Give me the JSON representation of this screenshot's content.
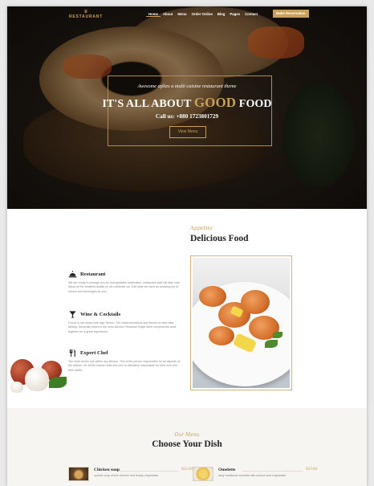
{
  "nav": {
    "logo_text": "RESTAURANT",
    "items": [
      "Home",
      "About",
      "Menu",
      "Order Online",
      "Blog",
      "Pages",
      "Contact"
    ],
    "active_item": "Home",
    "reserve_label": "Make Reservation"
  },
  "hero": {
    "subtitle": "Awesome aplies a multi cuisine restaurant theme",
    "title_pre": "IT'S ALL ABOUT ",
    "title_gold": "GOOD",
    "title_post": " FOOD",
    "call": "Call us: +880 1723801729",
    "button_label": "View Menu"
  },
  "about": {
    "script": "Appetite",
    "title": "Delicious Food",
    "features": [
      {
        "icon": "cloche-icon",
        "title": "Restaurant",
        "text": "We are ready to arrange you an unforgettable celebration, restaurant staff will take care about all the smallest details so we celebrate our 10th year we have an amazing list of menus and beverages for you."
      },
      {
        "icon": "cocktail-icon",
        "title": "Wine & Cocktails",
        "text": "Found in red wines with high Tannin. The initial sensations and flavors of wine after tasting. Generally refers to the ones Alcohol, Residual Sugar other components work together for a great experience."
      },
      {
        "icon": "cutlery-icon",
        "title": "Expert Chef",
        "text": "The most senior role within any kitchen. This is the person responsible for all aspects of the kitchen, for all the kitchen staff and who is ultimately responsible for their won and their staff's."
      }
    ]
  },
  "menu": {
    "script": "Our Menu",
    "title": "Choose Your Dish",
    "dishes": [
      {
        "name": "Chicken soup",
        "desc": "special soup where chicken and hearty vegetables",
        "price": "$25.00"
      },
      {
        "name": "Omelette",
        "desc": "tasty traditional omelette with cheese and vegetables",
        "price": "$10.00"
      }
    ]
  },
  "colors": {
    "accent": "#c9a05a",
    "dark": "#222222",
    "muted": "#888888"
  }
}
